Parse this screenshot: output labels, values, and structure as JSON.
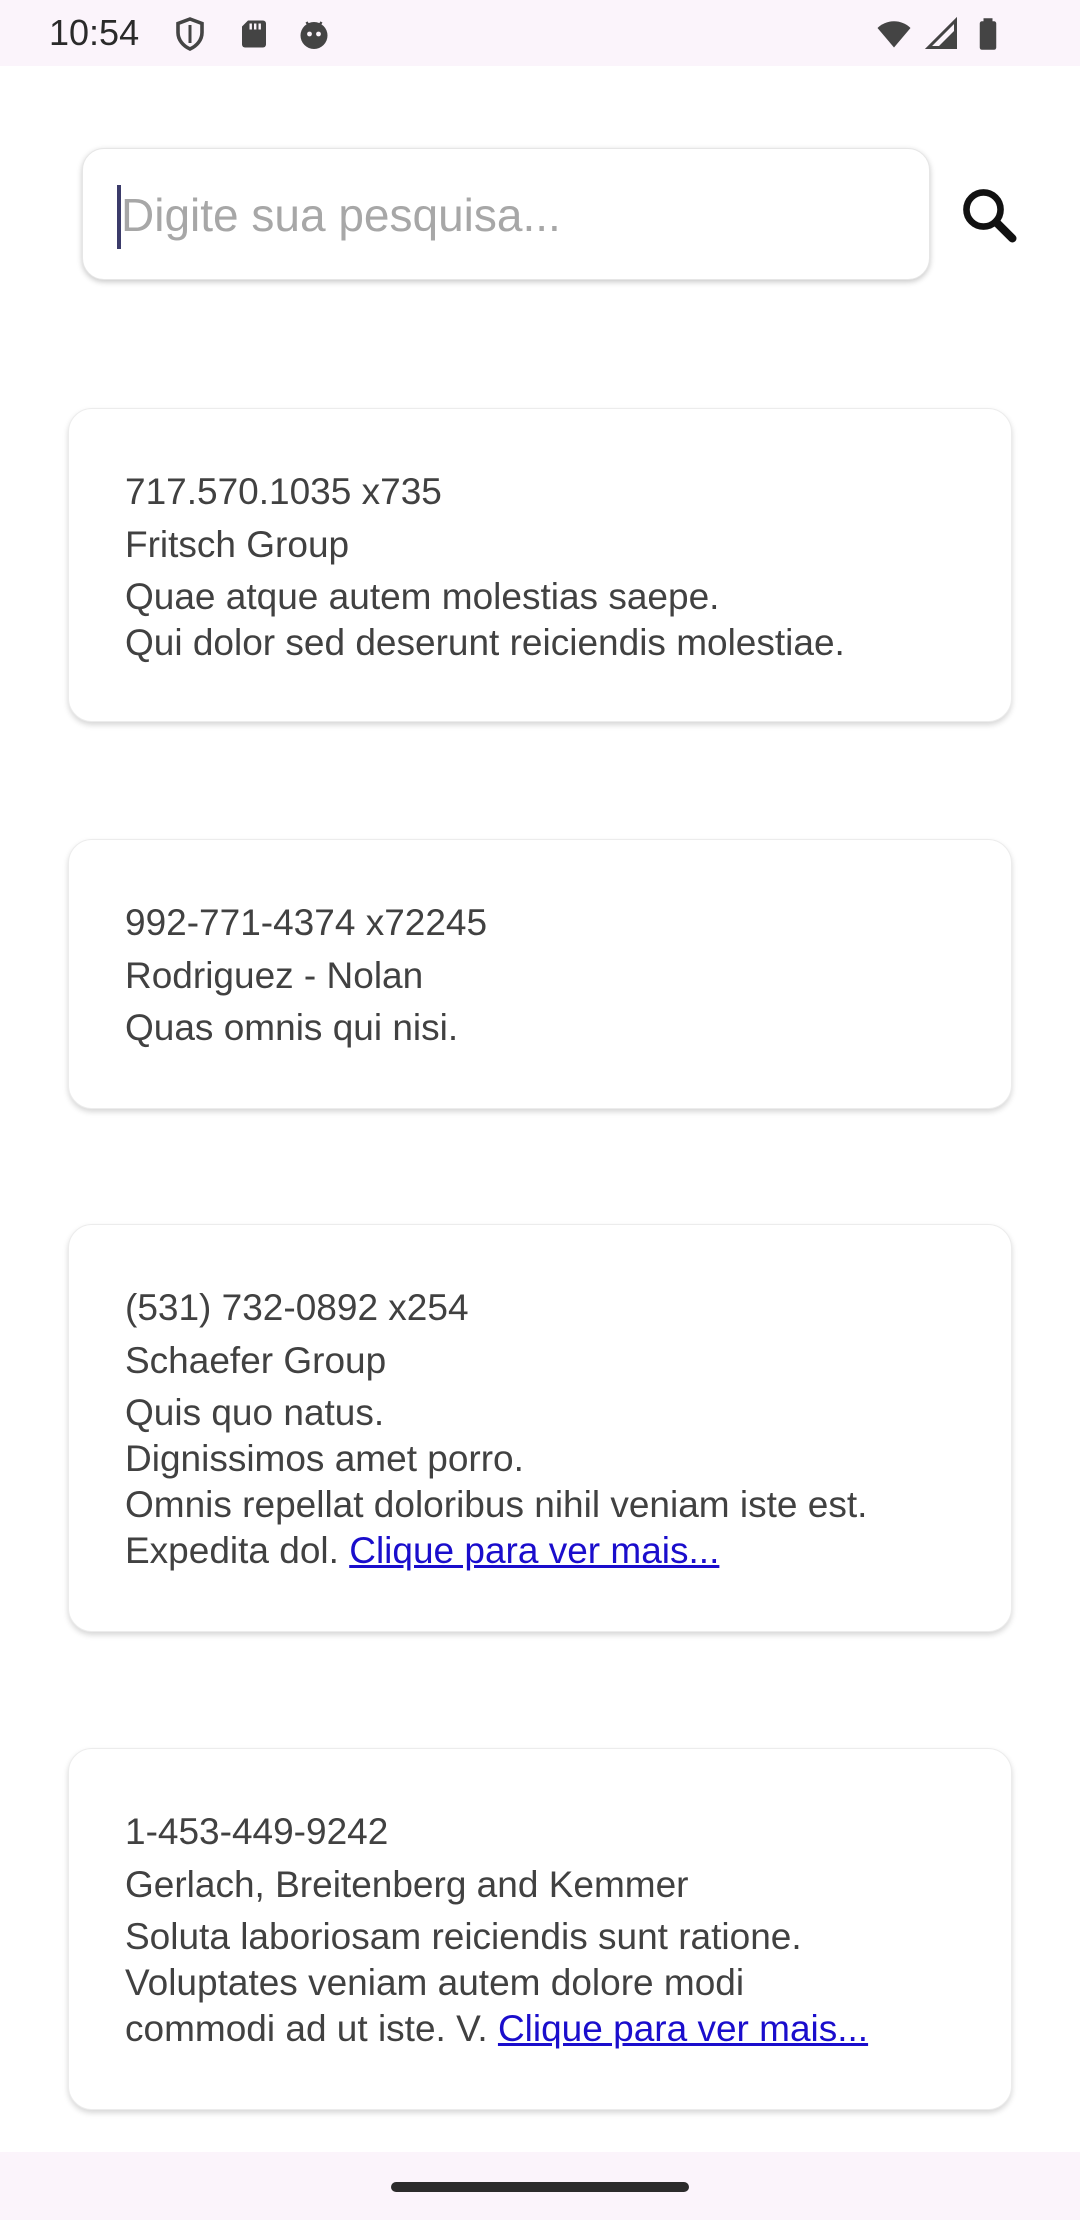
{
  "status_bar": {
    "time": "10:54",
    "icons_left": [
      "shield-icon",
      "sd-card-icon",
      "android-debug-icon"
    ],
    "icons_right": [
      "wifi-icon",
      "signal-icon",
      "battery-icon"
    ]
  },
  "search": {
    "placeholder": "Digite sua pesquisa...",
    "value": ""
  },
  "cards": [
    {
      "phone": "717.570.1035 x735",
      "company": "Fritsch Group",
      "description": "Quae atque autem molestias saepe.\nQui dolor sed deserunt reiciendis molestiae.",
      "more": ""
    },
    {
      "phone": "992-771-4374 x72245",
      "company": "Rodriguez - Nolan",
      "description": "Quas omnis qui nisi.",
      "more": ""
    },
    {
      "phone": "(531) 732-0892 x254",
      "company": "Schaefer Group",
      "description": "Quis quo natus.\nDignissimos amet porro.\nOmnis repellat doloribus nihil veniam iste est.\nExpedita dol. ",
      "more": "Clique para ver mais..."
    },
    {
      "phone": "1-453-449-9242",
      "company": "Gerlach, Breitenberg and Kemmer",
      "description": "Soluta laboriosam reiciendis sunt ratione.\nVoluptates veniam autem dolore modi\ncommodi ad ut iste. V. ",
      "more": "Clique para ver mais..."
    }
  ],
  "colors": {
    "link": "#1a0dcc",
    "text": "#414141",
    "system_bar": "#fbf4fb"
  }
}
